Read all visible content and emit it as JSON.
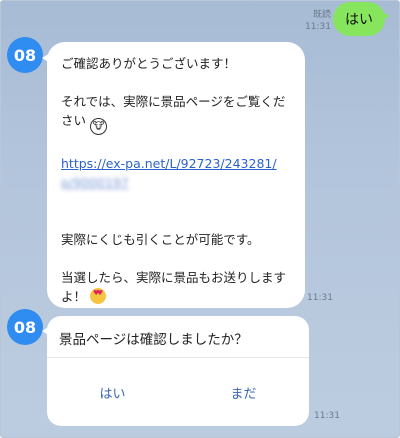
{
  "outgoing": {
    "text": "はい",
    "read_label": "既読",
    "time": "11:31",
    "color": "#86e55c"
  },
  "avatar": {
    "label": "08",
    "color": "#2f8cf0"
  },
  "message1": {
    "line1": "ご確認ありがとうございます！",
    "line2": "それでは、実際に景品ページをご覧ください",
    "link_visible": "https://ex-pa.net/L/92723/243281/",
    "link_blurred": "p/9000197",
    "line3": "実際にくじも引くことが可能です。",
    "line4": "当選したら、実際に景品もお送りしますよ！",
    "emoji1": "cow-emoji",
    "emoji2": "heart-eyes-emoji",
    "time": "11:31"
  },
  "message2": {
    "question": "景品ページは確認しましたか？",
    "button_yes": "はい",
    "button_not_yet": "まだ",
    "time": "11:31"
  }
}
